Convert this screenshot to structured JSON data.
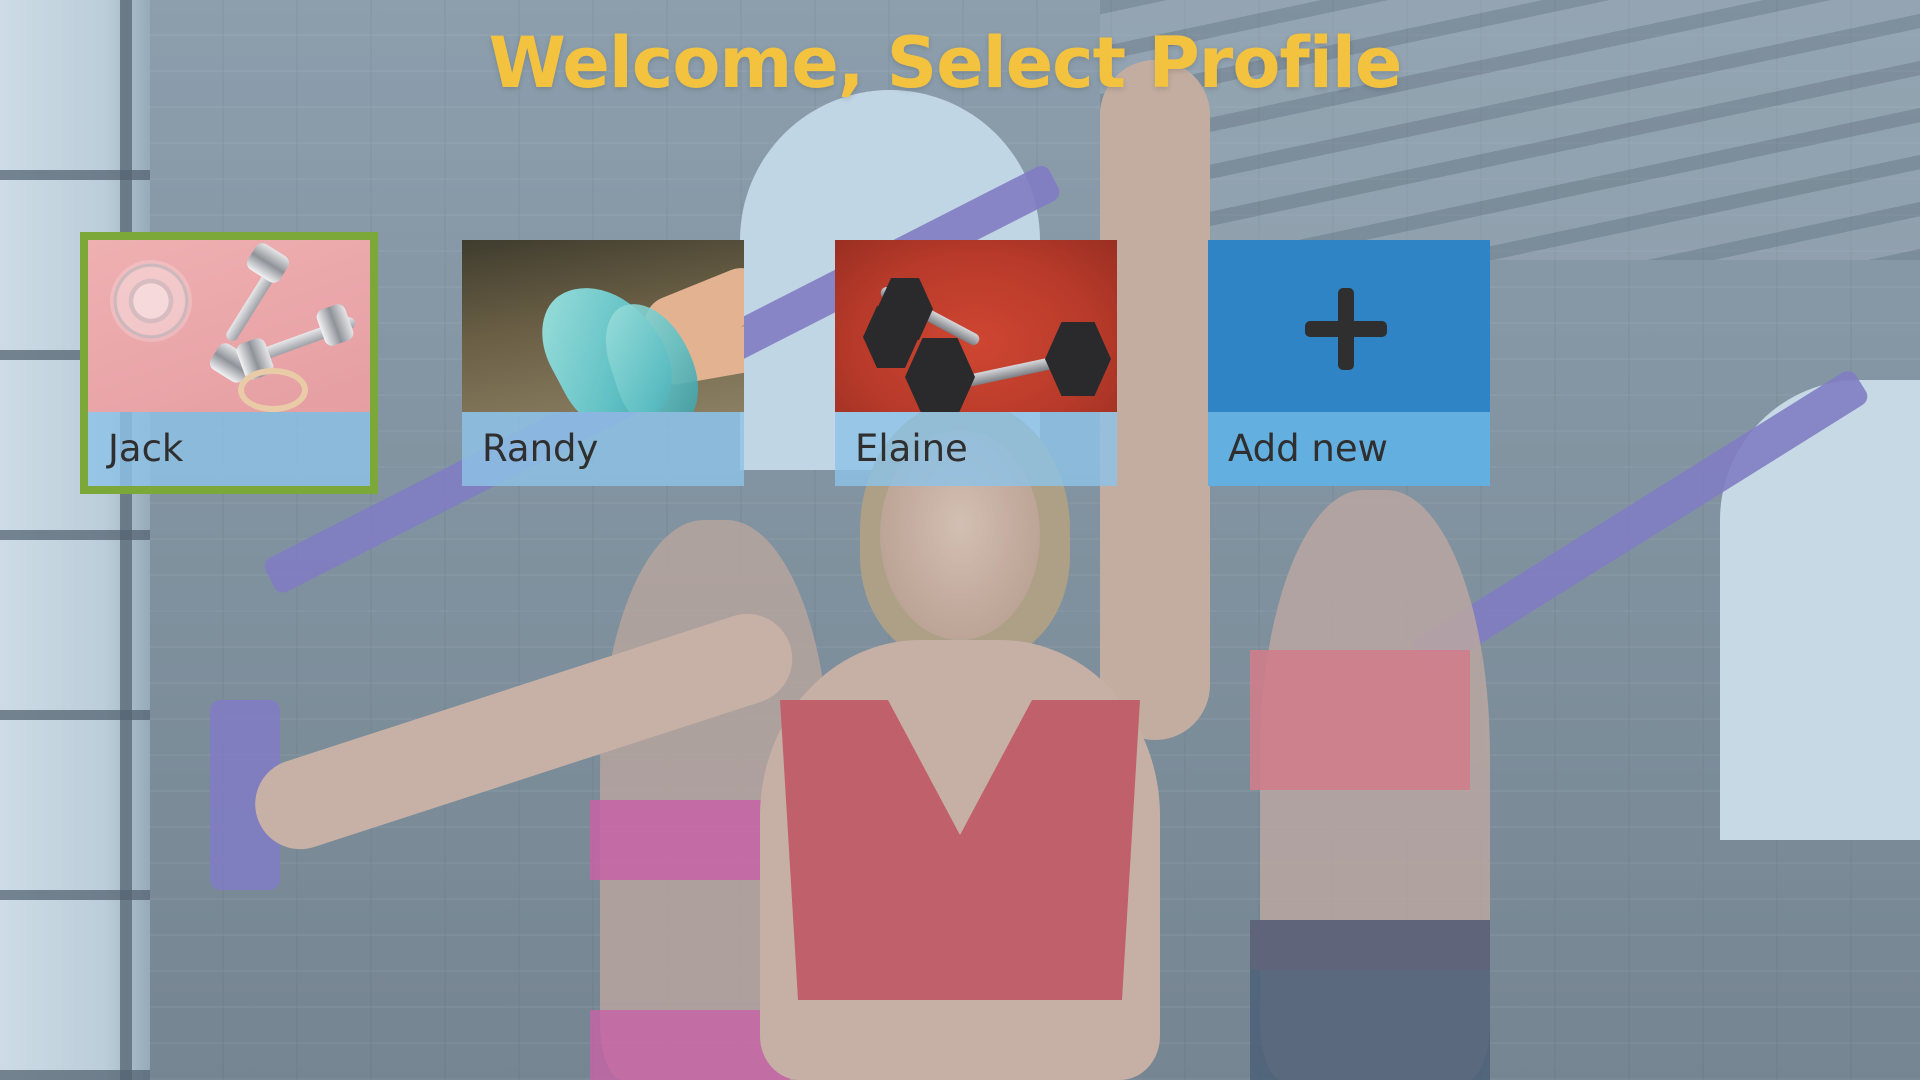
{
  "header": {
    "title": "Welcome, Select Profile"
  },
  "profiles": [
    {
      "name": "Jack",
      "selected": true,
      "image_icon": "dumbbells-pink-photo"
    },
    {
      "name": "Randy",
      "selected": false,
      "image_icon": "sneakers-photo"
    },
    {
      "name": "Elaine",
      "selected": false,
      "image_icon": "hex-dumbbells-photo"
    }
  ],
  "add_profile": {
    "label": "Add new",
    "icon": "plus-icon"
  },
  "colors": {
    "title": "#f3c33f",
    "selected_outline": "#7ca83a",
    "label_bg": "#8ec2e6",
    "add_tile_bg": "#2f84c6",
    "add_label_bg": "#63afe0"
  }
}
